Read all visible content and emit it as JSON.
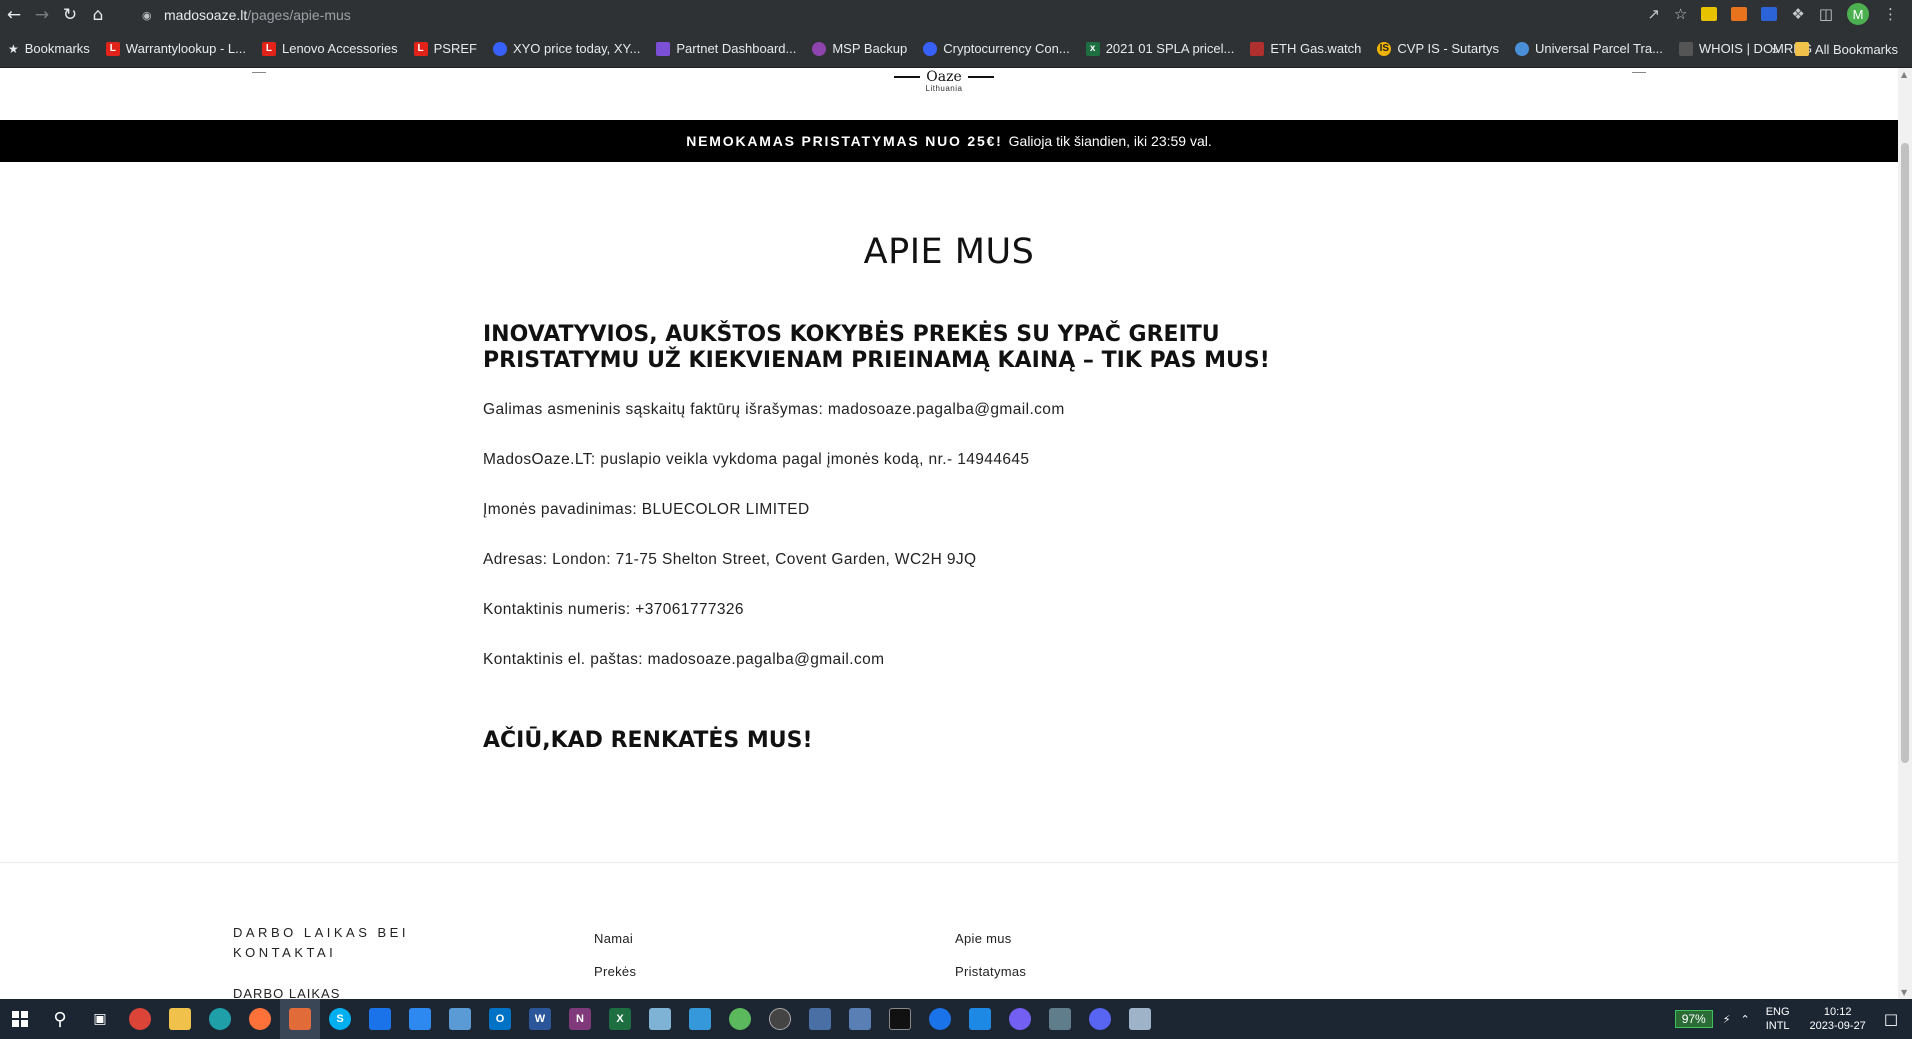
{
  "browser": {
    "url_domain": "madosoaze.lt",
    "url_path": "/pages/apie-mus",
    "avatar_letter": "M"
  },
  "bookmarks": {
    "items": [
      {
        "label": "Bookmarks",
        "icon": "star-icon",
        "color": "#e8eaed"
      },
      {
        "label": "Warrantylookup - L...",
        "icon": "lenovo-icon",
        "color": "#e2231a"
      },
      {
        "label": "Lenovo Accessories",
        "icon": "lenovo-icon",
        "color": "#e2231a"
      },
      {
        "label": "PSREF",
        "icon": "lenovo-icon",
        "color": "#e2231a"
      },
      {
        "label": "XYO price today, XY...",
        "icon": "coinmarketcap-icon",
        "color": "#3861fb"
      },
      {
        "label": "Partnet Dashboard...",
        "icon": "shield-icon",
        "color": "#7b4fd6"
      },
      {
        "label": "MSP Backup",
        "icon": "msp-icon",
        "color": "#8e44ad"
      },
      {
        "label": "Cryptocurrency Con...",
        "icon": "coinmarketcap-icon",
        "color": "#3861fb"
      },
      {
        "label": "2021 01 SPLA pricel...",
        "icon": "excel-icon",
        "color": "#1d6f42"
      },
      {
        "label": "ETH Gas.watch",
        "icon": "gas-icon",
        "color": "#b03030"
      },
      {
        "label": "CVP IS - Sutartys",
        "icon": "cvp-icon",
        "color": "#f0b400"
      },
      {
        "label": "Universal Parcel Tra...",
        "icon": "globe-icon",
        "color": "#4a90d9"
      },
      {
        "label": "WHOIS | DOMREG",
        "icon": "domreg-icon",
        "color": "#555555"
      }
    ],
    "overflow": "»",
    "all_bookmarks": "All Bookmarks"
  },
  "site": {
    "logo_name": "Oaze",
    "logo_sub": "Lithuania"
  },
  "promo": {
    "strong": "NEMOKAMAS PRISTATYMAS NUO 25€!",
    "rest": "Galioja tik šiandien, iki 23:59 val."
  },
  "page": {
    "title": "APIE MUS",
    "heading": "INOVATYVIOS, AUKŠTOS KOKYBĖS PREKĖS SU YPAČ GREITU PRISTATYMU UŽ KIEKVIENAM PRIEINAMĄ KAINĄ – TIK PAS MUS!",
    "paragraphs": [
      "Galimas asmeninis sąskaitų faktūrų išrašymas: madosoaze.pagalba@gmail.com",
      "MadosOaze.LT: puslapio veikla vykdoma pagal įmonės kodą, nr.- 14944645",
      "Įmonės pavadinimas: BLUECOLOR LIMITED",
      "Adresas: London: 71-75 Shelton Street, Covent Garden, WC2H 9JQ",
      "Kontaktinis numeris: +37061777326",
      "Kontaktinis el. paštas: madosoaze.pagalba@gmail.com"
    ],
    "closing": "AČIŪ,KAD RENKATĖS MUS!"
  },
  "footer": {
    "heading": "DARBO LAIKAS BEI KONTAKTAI",
    "sub": "DARBO LAIKAS",
    "col2": [
      "Namai",
      "Prekės"
    ],
    "col3": [
      "Apie mus",
      "Pristatymas"
    ]
  },
  "taskbar": {
    "battery": "97%",
    "lang_line1": "ENG",
    "lang_line2": "INTL",
    "time": "10:12",
    "date": "2023-09-27"
  }
}
